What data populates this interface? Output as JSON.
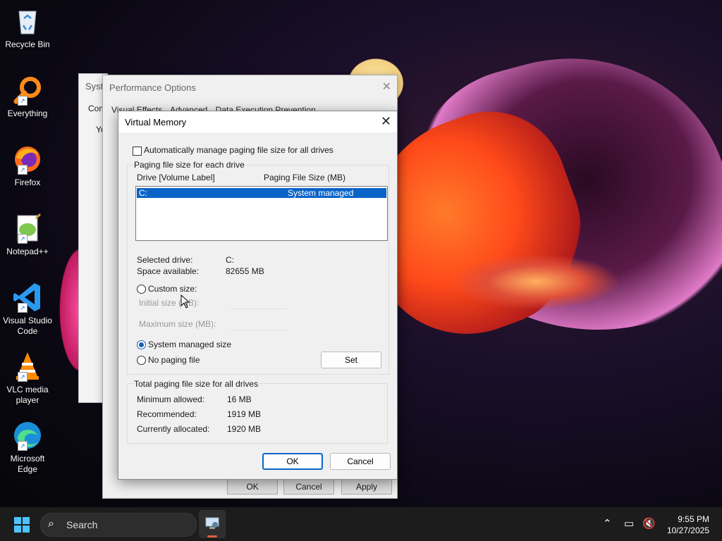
{
  "desktop": {
    "icons": [
      {
        "label": "Recycle Bin"
      },
      {
        "label": "Everything"
      },
      {
        "label": "Firefox"
      },
      {
        "label": "Notepad++"
      },
      {
        "label": "Visual Studio Code"
      },
      {
        "label": "VLC media player"
      },
      {
        "label": "Microsoft Edge"
      }
    ]
  },
  "system_window": {
    "title_partial": "Syste",
    "tab_partial": "Com",
    "text_partial": "Yo"
  },
  "performance_options": {
    "title": "Performance Options",
    "tabs": [
      "Visual Effects",
      "Advanced",
      "Data Execution Prevention"
    ],
    "buttons": {
      "ok": "OK",
      "cancel": "Cancel",
      "apply": "Apply"
    }
  },
  "virtual_memory": {
    "title": "Virtual Memory",
    "auto_manage_label": "Automatically manage paging file size for all drives",
    "auto_manage_checked": false,
    "group_paging_label": "Paging file size for each drive",
    "col_drive": "Drive  [Volume Label]",
    "col_size": "Paging File Size (MB)",
    "drives": [
      {
        "drive": "C:",
        "size": "System managed"
      }
    ],
    "selected_drive_label": "Selected drive:",
    "selected_drive_value": "C:",
    "space_available_label": "Space available:",
    "space_available_value": "82655 MB",
    "custom_size_label": "Custom size:",
    "initial_size_label": "Initial size (MB):",
    "maximum_size_label": "Maximum size (MB):",
    "system_managed_label": "System managed size",
    "no_paging_label": "No paging file",
    "set_button": "Set",
    "totals_group_label": "Total paging file size for all drives",
    "min_allowed_label": "Minimum allowed:",
    "min_allowed_value": "16 MB",
    "recommended_label": "Recommended:",
    "recommended_value": "1919 MB",
    "current_label": "Currently allocated:",
    "current_value": "1920 MB",
    "ok_button": "OK",
    "cancel_button": "Cancel"
  },
  "taskbar": {
    "search_placeholder": "Search",
    "time": "9:55 PM",
    "date": "10/27/2025"
  },
  "colors": {
    "accent": "#0a64c8",
    "taskbar": "#1c1c1c"
  }
}
